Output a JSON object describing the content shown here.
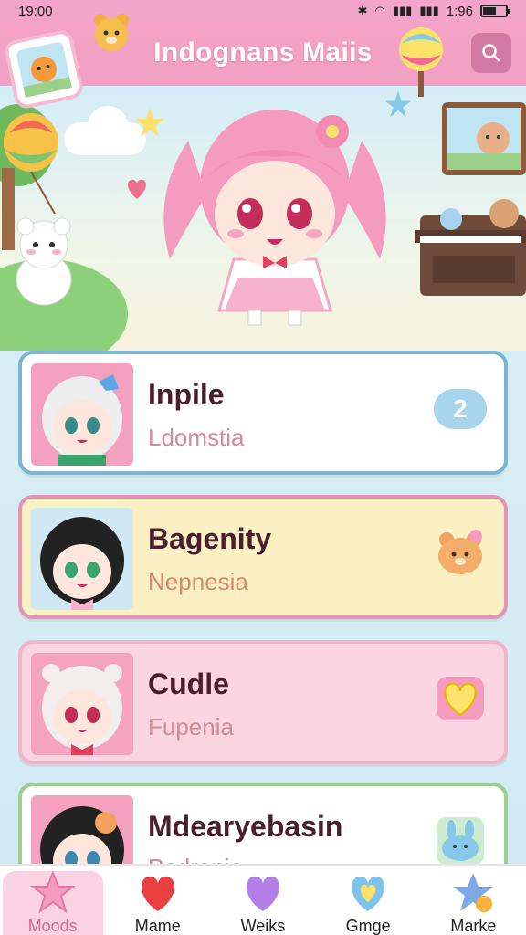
{
  "status_bar": {
    "time": "19:00",
    "right_time": "1:96"
  },
  "header": {
    "title": "Indognans Maiis"
  },
  "cards": [
    {
      "name": "Inpile",
      "subtitle": "Ldomstia",
      "badge_value": "2",
      "badge_icon": "cloud-icon"
    },
    {
      "name": "Bagenity",
      "subtitle": "Nepnesia",
      "badge_icon": "bear-icon"
    },
    {
      "name": "Cudle",
      "subtitle": "Fupenia",
      "badge_icon": "heart-icon"
    },
    {
      "name": "Mdearyebasin",
      "subtitle": "Pedrenia",
      "badge_icon": "bunny-icon"
    }
  ],
  "bottom_nav": [
    {
      "label": "Moods",
      "icon": "star-icon",
      "active": true
    },
    {
      "label": "Mame",
      "icon": "heart-icon"
    },
    {
      "label": "Weiks",
      "icon": "heart-icon"
    },
    {
      "label": "Gmge",
      "icon": "heart-icon"
    },
    {
      "label": "Marke",
      "icon": "star-icon"
    }
  ],
  "colors": {
    "header": "#f1a0c4",
    "card1_border": "#7ab3d6",
    "card2_border": "#e592b6",
    "card3_border": "#f2b4c9",
    "card4_border": "#9ccf8d",
    "active_nav": "#d06b96"
  }
}
